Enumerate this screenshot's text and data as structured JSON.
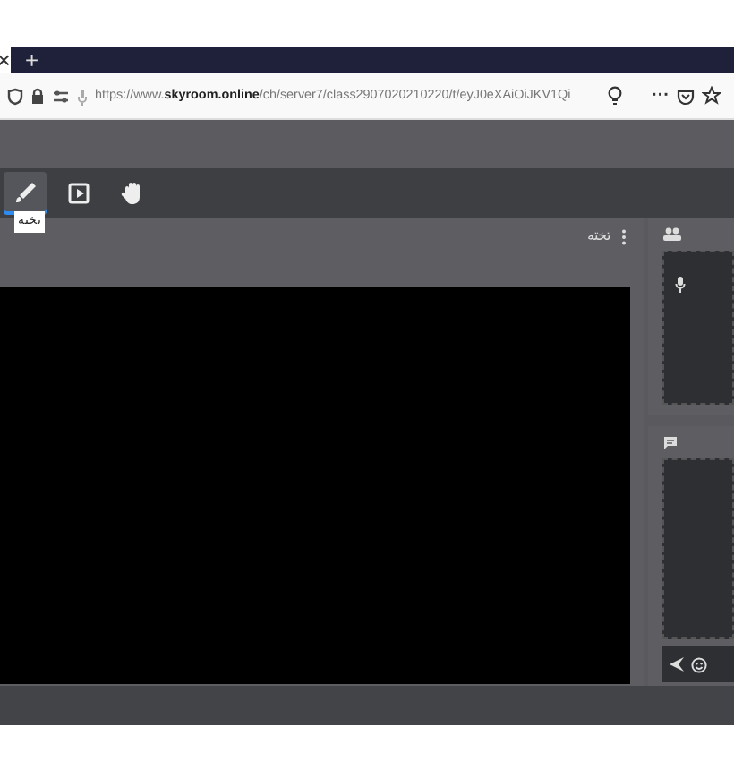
{
  "browser": {
    "tab_close": "×",
    "new_tab": "+",
    "url": "https://www.**skyroom.online**/ch/server7/class2907020210220/t/eyJ0eXAiOiJKV1Qi",
    "menu": "···"
  },
  "toolbar": {
    "tools": [
      {
        "kind": "brush",
        "selected": true
      },
      {
        "kind": "play",
        "selected": false
      },
      {
        "kind": "hand",
        "selected": false
      }
    ],
    "tooltip": "تخته"
  },
  "board": {
    "title": "تخته"
  }
}
